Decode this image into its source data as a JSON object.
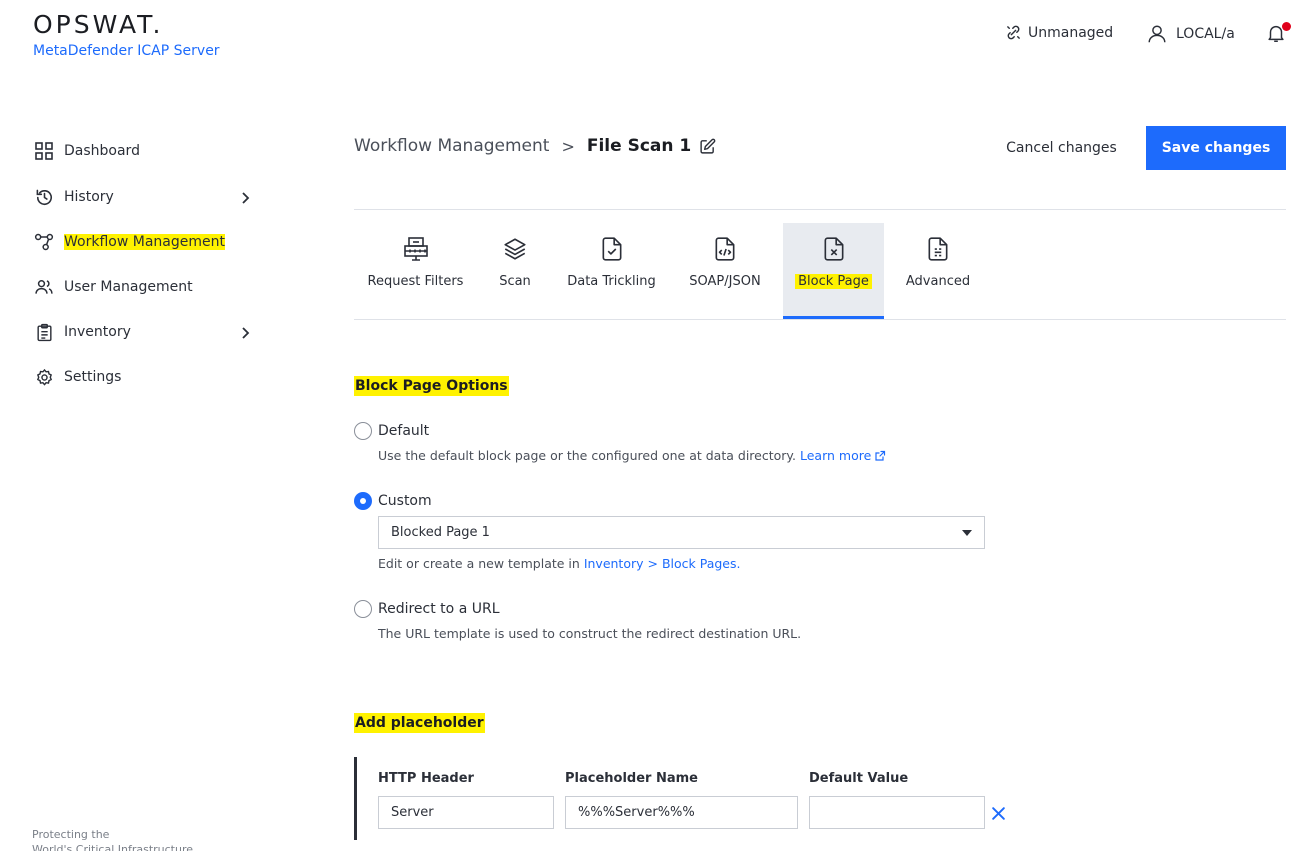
{
  "brand": {
    "name": "OPSWAT.",
    "product": "MetaDefender ICAP Server"
  },
  "header": {
    "unmanaged_label": "Unmanaged",
    "user_label": "LOCAL/a",
    "icons": [
      "unlink-icon",
      "user-icon",
      "bell-icon"
    ]
  },
  "sidebar": {
    "items": [
      {
        "label": "Dashboard",
        "icon": "grid-icon"
      },
      {
        "label": "History",
        "icon": "history-icon",
        "has_submenu": true
      },
      {
        "label": "Workflow Management",
        "icon": "workflow-icon",
        "active": true
      },
      {
        "label": "User Management",
        "icon": "users-icon"
      },
      {
        "label": "Inventory",
        "icon": "clipboard-icon",
        "has_submenu": true
      },
      {
        "label": "Settings",
        "icon": "gear-icon"
      }
    ],
    "footer_line1": "Protecting the",
    "footer_line2": "World's Critical Infrastructure"
  },
  "breadcrumb": {
    "root": "Workflow Management",
    "separator": ">",
    "current": "File Scan 1"
  },
  "actions": {
    "cancel_label": "Cancel changes",
    "save_label": "Save changes"
  },
  "tabs": [
    {
      "label": "Request Filters",
      "icon": "request-filter-icon"
    },
    {
      "label": "Scan",
      "icon": "layers-icon"
    },
    {
      "label": "Data Trickling",
      "icon": "file-check-icon"
    },
    {
      "label": "SOAP/JSON",
      "icon": "file-code-icon"
    },
    {
      "label": "Block Page",
      "icon": "file-x-icon",
      "active": true
    },
    {
      "label": "Advanced",
      "icon": "file-settings-icon"
    }
  ],
  "block_page_options": {
    "title": "Block Page Options",
    "options": [
      {
        "label": "Default",
        "checked": false,
        "description": "Use the default block page or the configured one at data directory.",
        "link": "Learn more"
      },
      {
        "label": "Custom",
        "checked": true,
        "description_prefix": "Edit or create a new template in ",
        "link": "Inventory > Block Pages."
      },
      {
        "label": "Redirect to a URL",
        "checked": false,
        "description": "The URL template is used to construct the redirect destination URL."
      }
    ],
    "custom_select_value": "Blocked Page 1"
  },
  "placeholder": {
    "title": "Add placeholder",
    "columns": [
      "HTTP Header",
      "Placeholder Name",
      "Default Value"
    ],
    "rows": [
      {
        "http_header": "Server",
        "placeholder_name": "%%%Server%%%",
        "default_value": ""
      }
    ]
  },
  "colors": {
    "accent": "#1d6bfc",
    "highlight": "#fff200",
    "notification": "#e0001b"
  }
}
